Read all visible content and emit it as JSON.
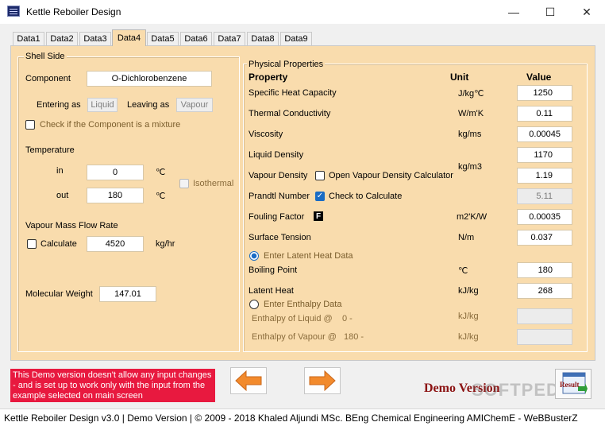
{
  "window": {
    "title": "Kettle Reboiler Design",
    "minimize": "—",
    "maximize": "☐",
    "close": "✕"
  },
  "tabs": [
    "Data1",
    "Data2",
    "Data3",
    "Data4",
    "Data5",
    "Data6",
    "Data7",
    "Data8",
    "Data9"
  ],
  "active_tab": "Data4",
  "shell_side": {
    "title": "Shell Side",
    "component_label": "Component",
    "component_value": "O-Dichlorobenzene",
    "entering_as_label": "Entering as",
    "entering_as_value": "Liquid",
    "leaving_as_label": "Leaving as",
    "leaving_as_value": "Vapour",
    "mixture_label": "Check if the Component is a mixture",
    "temperature_label": "Temperature",
    "in_label": "in",
    "in_value": "0",
    "out_label": "out",
    "out_value": "180",
    "temp_unit": "℃",
    "isothermal_label": "Isothermal",
    "vapour_flow_label": "Vapour Mass Flow Rate",
    "calculate_label": "Calculate",
    "flow_value": "4520",
    "flow_unit": "kg/hr",
    "mw_label": "Molecular Weight",
    "mw_value": "147.01"
  },
  "physical": {
    "title": "Physical Properties",
    "col_property": "Property",
    "col_unit": "Unit",
    "col_value": "Value",
    "rows": {
      "specific_heat": {
        "label": "Specific Heat Capacity",
        "unit": "J/kg℃",
        "value": "1250"
      },
      "thermal_cond": {
        "label": "Thermal Conductivity",
        "unit": "W/m'K",
        "value": "0.11"
      },
      "viscosity": {
        "label": "Viscosity",
        "unit": "kg/ms",
        "value": "0.00045"
      },
      "liquid_density": {
        "label": "Liquid Density",
        "value": "1170"
      },
      "density_unit": "kg/m3",
      "vapour_density": {
        "label": "Vapour Density",
        "calc_label": "Open Vapour Density Calculator",
        "value": "1.19"
      },
      "prandtl": {
        "label": "Prandtl Number",
        "calc_label": "Check to Calculate",
        "value": "5.11"
      },
      "fouling": {
        "label": "Fouling Factor",
        "badge": "F",
        "unit": "m2'K/W",
        "value": "0.00035"
      },
      "surface_tension": {
        "label": "Surface Tension",
        "unit": "N/m",
        "value": "0.037"
      },
      "latent_option": "Enter Latent Heat Data",
      "boiling_point": {
        "label": "Boiling Point",
        "unit": "℃",
        "value": "180"
      },
      "latent_heat": {
        "label": "Latent Heat",
        "unit": "kJ/kg",
        "value": "268"
      },
      "enthalpy_option": "Enter Enthalpy Data",
      "enthalpy_liquid": {
        "label": "Enthalpy of Liquid @",
        "temp": "0 -",
        "unit": "kJ/kg"
      },
      "enthalpy_vapour": {
        "label": "Enthalpy of Vapour @",
        "temp": "180 -",
        "unit": "kJ/kg"
      }
    }
  },
  "footer": {
    "demo_note": "This Demo version doesn't allow any input changes - and is set up to work only with the input from the example selected on main screen",
    "demo_version": "Demo Version",
    "result_label": "Result",
    "watermark": "SOFTPEDIA",
    "status": "Kettle Reboiler Design  v3.0  |  Demo Version  |  © 2009 - 2018 Khaled Aljundi MSc. BEng Chemical Engineering AMIChemE - WeBBusterZ"
  },
  "colors": {
    "panel": "#f9dcad",
    "demo_note_bg": "#e8193f",
    "arrow": "#f28a2c",
    "demo_version": "#8b1212",
    "check_on": "#1a6cc4"
  }
}
